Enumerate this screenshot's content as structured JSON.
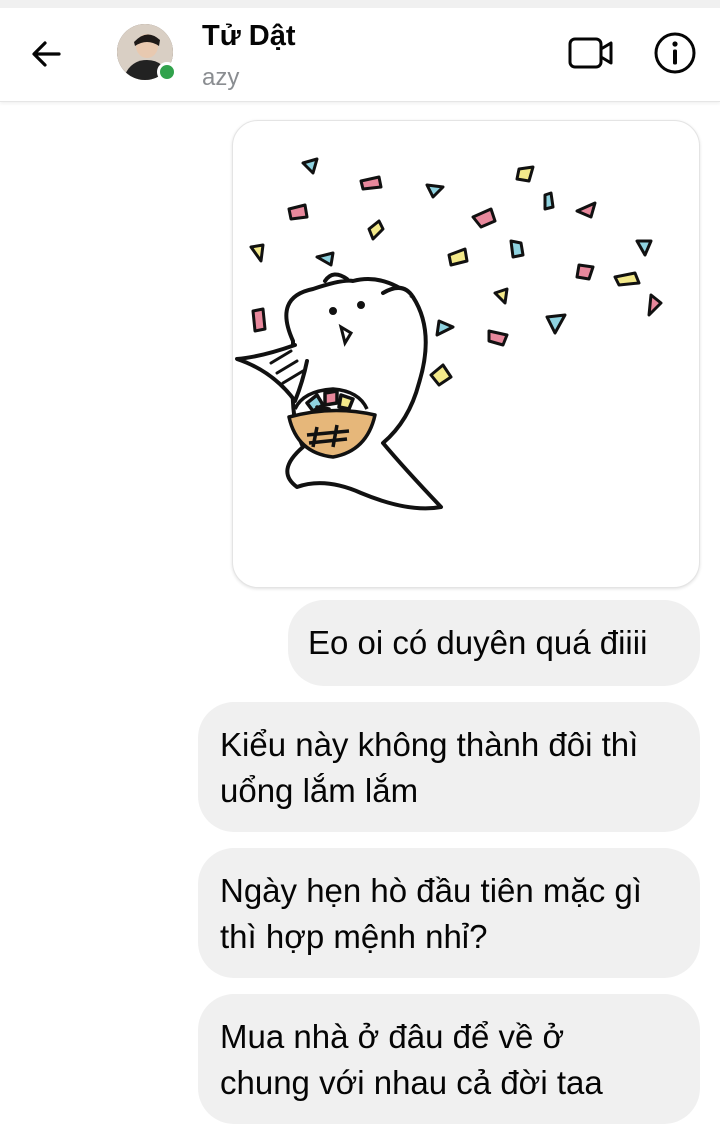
{
  "header": {
    "contact_name": "Tử Dật",
    "status": "azy",
    "avatar": "profile-photo",
    "online": true,
    "icons": {
      "back": "arrow-left-icon",
      "video": "video-camera-icon",
      "info": "info-icon"
    }
  },
  "sticker": {
    "description": "cat-throwing-confetti",
    "colors": {
      "pink": "#e8889c",
      "yellow": "#f3e98a",
      "blue": "#8fd3e0",
      "basket": "#e6b77a"
    }
  },
  "messages": [
    {
      "lines": [
        "Eo oi có duyên quá điiii"
      ]
    },
    {
      "lines": [
        "Kiểu này không thành đôi thì",
        "uổng lắm lắm"
      ]
    },
    {
      "lines": [
        "Ngày hẹn hò đầu tiên mặc gì",
        "thì hợp mệnh nhỉ?"
      ]
    },
    {
      "lines": [
        "Mua nhà ở đâu để về ở",
        "chung với nhau cả đời taa"
      ]
    }
  ],
  "colors": {
    "online": "#31a24c",
    "bubble": "#f0f0f0",
    "status_text": "#8a8d91"
  }
}
